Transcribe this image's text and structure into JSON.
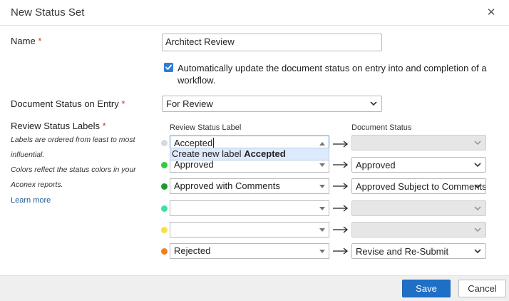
{
  "dialog": {
    "title": "New Status Set",
    "close_icon": "close-icon",
    "close_glyph": "✕"
  },
  "form": {
    "name_label": "Name",
    "required_mark": "*",
    "name_value": "Architect Review",
    "auto_update_checked": true,
    "auto_update_text": "Automatically update the document status on entry into and completion of a workflow.",
    "entry_label": "Document Status on Entry",
    "entry_value": "For Review",
    "labels_label": "Review Status Labels",
    "hint_1": "Labels are ordered from least to most influential.",
    "hint_2": "Colors reflect the status colors in your Aconex reports.",
    "learn_more": "Learn more"
  },
  "table": {
    "col_label": "Review Status Label",
    "col_doc": "Document Status",
    "rows": [
      {
        "color": "#d9d9d9",
        "label": "Accepted",
        "doc_status": "",
        "doc_disabled": true,
        "editing": true
      },
      {
        "color": "#2ecc40",
        "label": "Approved",
        "doc_status": "Approved",
        "doc_disabled": false
      },
      {
        "color": "#1a9e2a",
        "label": "Approved with Comments",
        "doc_status": "Approved Subject to Comments",
        "doc_disabled": false
      },
      {
        "color": "#3ee0a0",
        "label": "",
        "doc_status": "",
        "doc_disabled": true
      },
      {
        "color": "#f5e046",
        "label": "",
        "doc_status": "",
        "doc_disabled": true
      },
      {
        "color": "#f0801e",
        "label": "Rejected",
        "doc_status": "Revise and Re-Submit",
        "doc_disabled": false
      }
    ],
    "suggestion_prefix": "Create new label",
    "suggestion_term": "Accepted"
  },
  "footer": {
    "save_label": "Save",
    "cancel_label": "Cancel",
    "accent": "#1f6fc6"
  }
}
